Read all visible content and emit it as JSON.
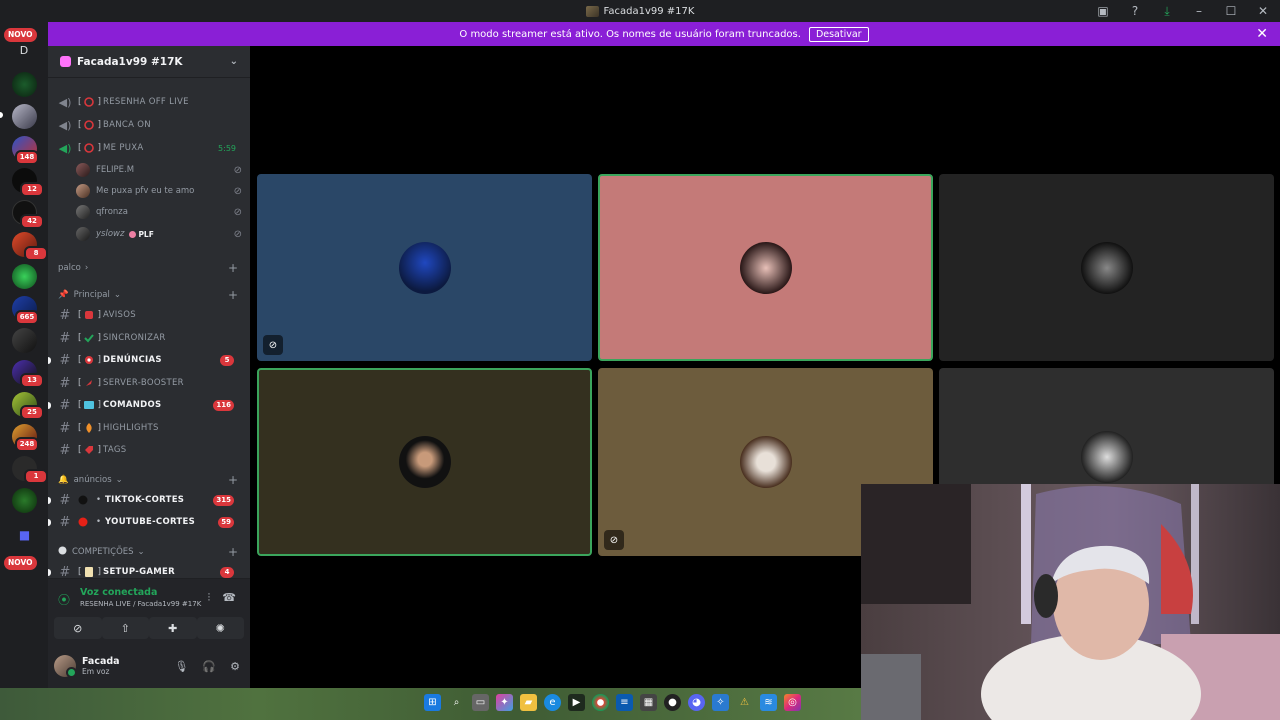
{
  "window": {
    "title": "Facada1v99 #17K"
  },
  "banner": {
    "text": "O modo streamer está ativo. Os nomes de usuário foram truncados.",
    "button": "Desativar"
  },
  "rail": {
    "top_badge": "NOVO",
    "dm_letter": "D",
    "bottom_badge": "NOVO",
    "server_badges": [
      "148",
      "12",
      "42",
      "8",
      "665",
      "13",
      "25",
      "248",
      "1"
    ]
  },
  "server": {
    "name": "Facada1v99 #17K"
  },
  "voice_channels": [
    {
      "name": "RESENHA OFF LIVE",
      "active": false
    },
    {
      "name": "BANCA ON",
      "active": false
    },
    {
      "name": "ME PUXA",
      "active": true,
      "timer": "5:59"
    }
  ],
  "voice_users": [
    {
      "name": "FELIPE.M",
      "italic": false
    },
    {
      "name": "Me puxa pfv eu te amo",
      "italic": false
    },
    {
      "name": "qfronza",
      "italic": false
    },
    {
      "name": "yslowz",
      "italic": true,
      "tag": "PLF"
    }
  ],
  "categories": {
    "palco": "palco",
    "principal": "Principal",
    "anuncios": "anúncios",
    "competicoes": "COMPETIÇÕES"
  },
  "text_channels": [
    {
      "name": "AVISOS",
      "unread": false
    },
    {
      "name": "SINCRONIZAR",
      "unread": false
    },
    {
      "name": "DENÚNCIAS",
      "unread": true,
      "badge": "5"
    },
    {
      "name": "SERVER-BOOSTER",
      "unread": false
    },
    {
      "name": "COMANDOS",
      "unread": true,
      "badge": "116"
    },
    {
      "name": "HIGHLIGHTS",
      "unread": false
    },
    {
      "name": "TAGS",
      "unread": false
    }
  ],
  "announce_channels": [
    {
      "name": "TIKTOK-CORTES",
      "unread": true,
      "badge": "315"
    },
    {
      "name": "YOUTUBE-CORTES",
      "unread": true,
      "badge": "59"
    }
  ],
  "competition_channels": [
    {
      "name": "SETUP-GAMER",
      "unread": true,
      "badge": "4"
    }
  ],
  "voice_panel": {
    "status": "Voz conectada",
    "location": "RESENHA LIVE / Facada1v99 #17K"
  },
  "me": {
    "name": "Facada",
    "status": "Em voz"
  },
  "colors": {
    "accent": "#8a1fd6",
    "speaking": "#3ba55c",
    "badge": "#da373c"
  }
}
